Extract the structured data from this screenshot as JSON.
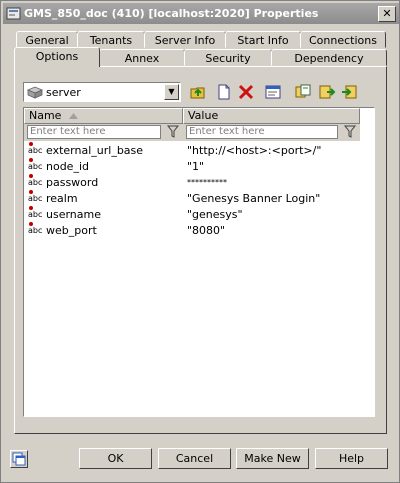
{
  "window": {
    "title": "GMS_850_doc (410) [localhost:2020] Properties",
    "close_label": "✕"
  },
  "tabs_back": [
    "General",
    "Tenants",
    "Server Info",
    "Start Info",
    "Connections"
  ],
  "tabs_front": [
    "Options",
    "Annex",
    "Security",
    "Dependency"
  ],
  "active_tab": "Options",
  "section_combo": {
    "value": "server"
  },
  "toolbar": [
    "folder-up-icon",
    "new-icon",
    "delete-icon",
    "properties-icon",
    "copy-icon",
    "export-icon",
    "import-icon"
  ],
  "grid": {
    "columns": [
      {
        "label": "Name",
        "sorted": "ascending"
      },
      {
        "label": "Value"
      }
    ],
    "filter_placeholder": "Enter text here",
    "type_badge": "abc",
    "rows": [
      {
        "name": "external_url_base",
        "value": "\"http://<host>:<port>/\""
      },
      {
        "name": "node_id",
        "value": "\"1\""
      },
      {
        "name": "password",
        "value": "**********"
      },
      {
        "name": "realm",
        "value": "\"Genesys Banner Login\""
      },
      {
        "name": "username",
        "value": "\"genesys\""
      },
      {
        "name": "web_port",
        "value": "\"8080\""
      }
    ]
  },
  "buttons": {
    "ok": "OK",
    "cancel": "Cancel",
    "make_new": "Make New",
    "help": "Help"
  },
  "colors": {
    "titlebar": "#999999",
    "face": "#d4d0c8",
    "delete_red": "#d01010"
  }
}
